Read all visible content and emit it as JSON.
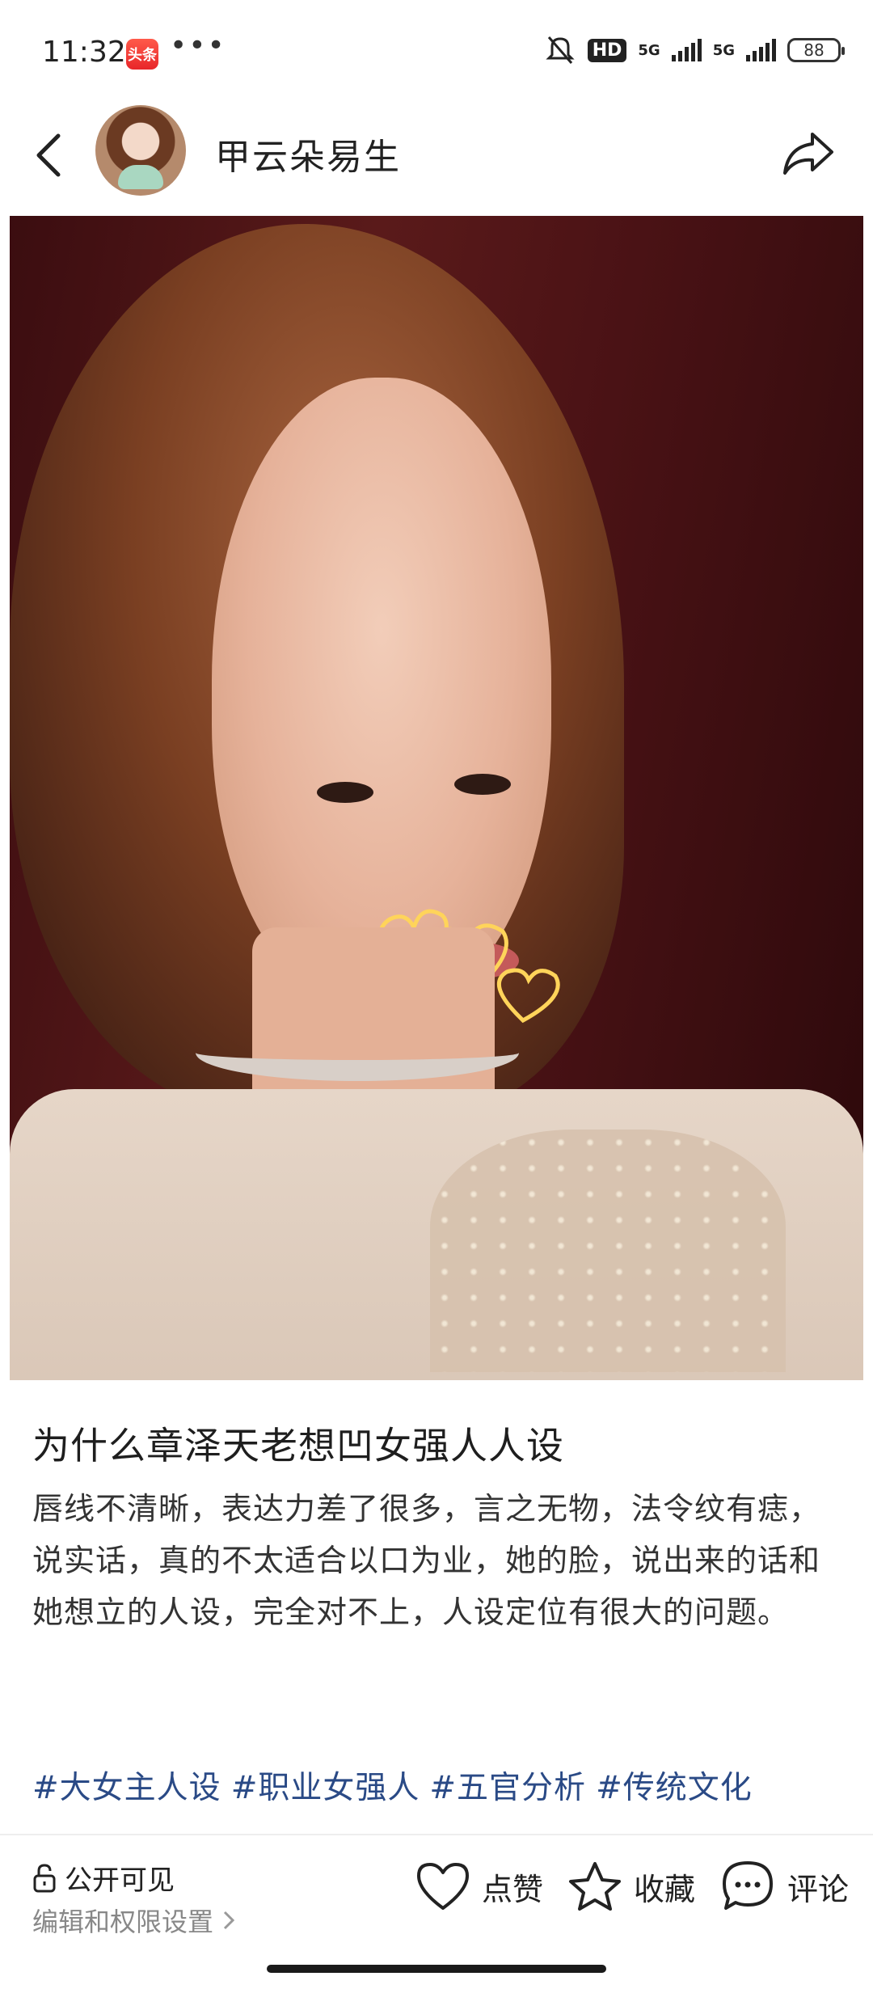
{
  "status_bar": {
    "time": "11:32",
    "app_icon_text": "头条",
    "more": "•••",
    "hd": "HD",
    "net1": "5G",
    "net2": "5G",
    "battery": "88"
  },
  "header": {
    "author_name": "甲云朵易生"
  },
  "post": {
    "title": "为什么章泽天老想凹女强人人设",
    "body": "唇线不清晰，表达力差了很多，言之无物，法令纹有痣，说实话，真的不太适合以口为业，她的脸，说出来的话和她想立的人设，完全对不上，人设定位有很大的问题。",
    "tags": [
      "#大女主人设",
      "#职业女强人",
      "#五官分析",
      "#传统文化"
    ]
  },
  "bottom_bar": {
    "visibility_label": "公开可见",
    "edit_permissions": "编辑和权限设置",
    "like_label": "点赞",
    "favorite_label": "收藏",
    "comment_label": "评论"
  }
}
